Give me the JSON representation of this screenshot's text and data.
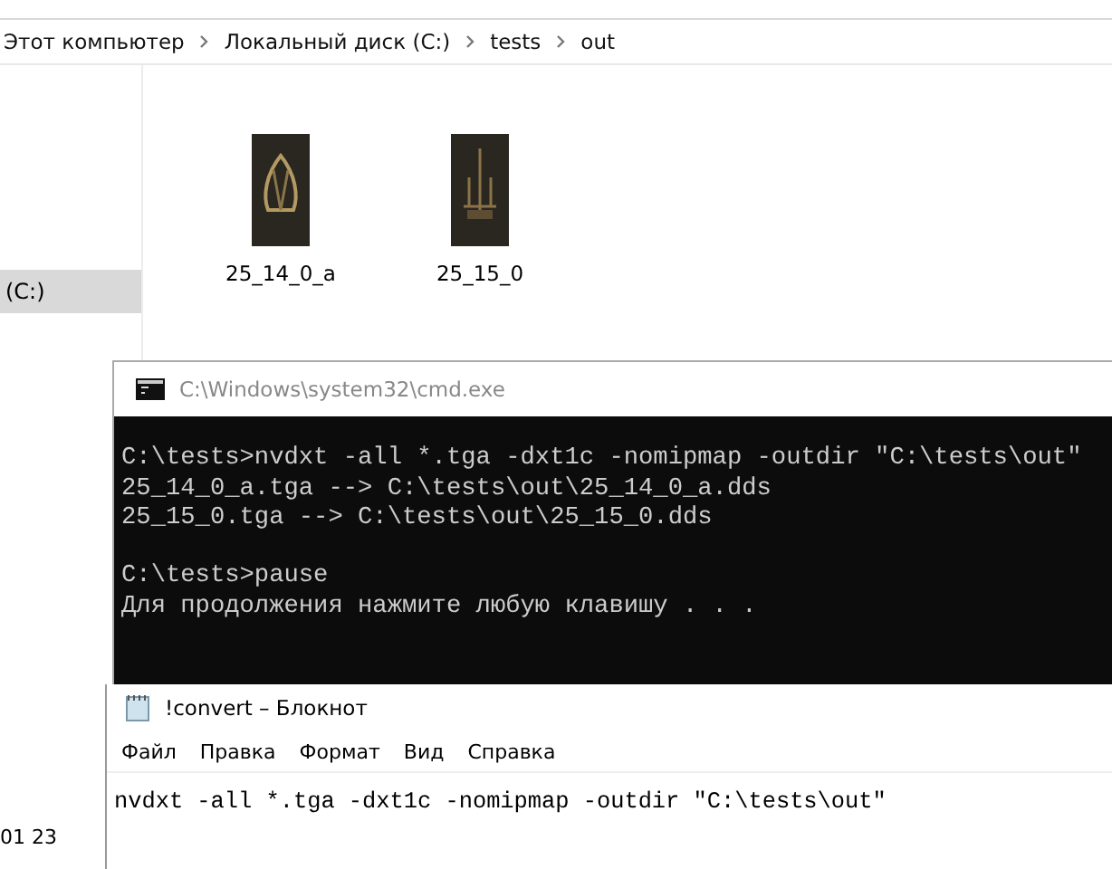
{
  "explorer": {
    "breadcrumb": [
      {
        "label": "Этот компьютер"
      },
      {
        "label": "Локальный диск (C:)"
      },
      {
        "label": "tests"
      },
      {
        "label": "out"
      }
    ],
    "sidebar": {
      "items": [
        {
          "label": "(C:)",
          "selected": true
        }
      ]
    },
    "files": [
      {
        "name": "25_14_0_a"
      },
      {
        "name": "25_15_0"
      }
    ],
    "status_text": "01 23"
  },
  "cmd_window": {
    "title": "C:\\Windows\\system32\\cmd.exe",
    "blocks": [
      [
        "C:\\tests>nvdxt -all *.tga -dxt1c -nomipmap -outdir \"C:\\tests\\out\"",
        "25_14_0_a.tga --> C:\\tests\\out\\25_14_0_a.dds",
        "25_15_0.tga --> C:\\tests\\out\\25_15_0.dds"
      ],
      [
        "C:\\tests>pause",
        "Для продолжения нажмите любую клавишу . . ."
      ]
    ]
  },
  "notepad_window": {
    "title": "!convert – Блокнот",
    "menu": [
      "Файл",
      "Правка",
      "Формат",
      "Вид",
      "Справка"
    ],
    "content": "nvdxt -all *.tga -dxt1c -nomipmap -outdir \"C:\\tests\\out\""
  }
}
